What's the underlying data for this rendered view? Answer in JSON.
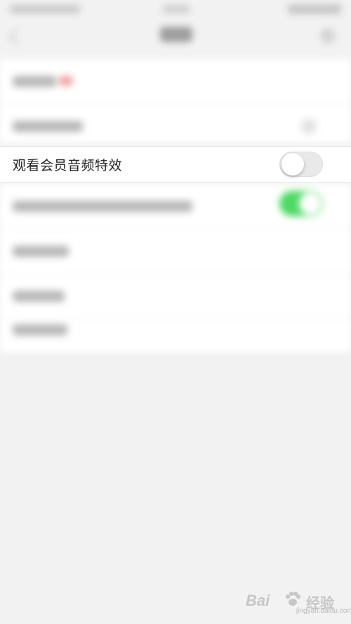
{
  "setting": {
    "label": "观看会员音频特效",
    "enabled": false
  },
  "watermark": {
    "brand": "Bai",
    "brand_tail": "经验",
    "url": "jingyan.baidu.com"
  }
}
